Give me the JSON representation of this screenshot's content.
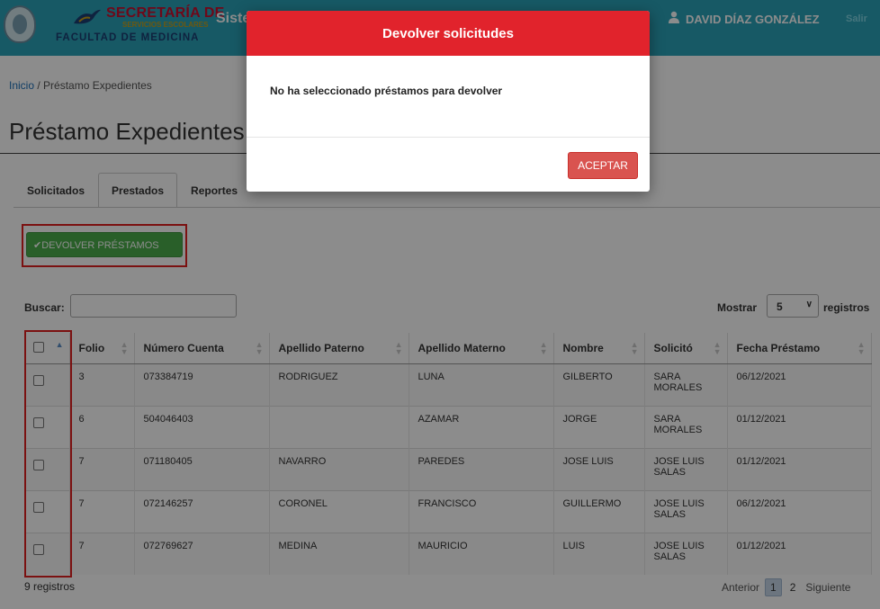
{
  "header": {
    "logo_line1": "SECRETARÍA DE",
    "logo_line2": "SERVICIOS ESCOLARES",
    "logo_line3": "FACULTAD DE MEDICINA",
    "system_title": "Siste",
    "user_name": "DAVID DÍAZ GONZÁLEZ",
    "logout_label": "Salir"
  },
  "breadcrumb": {
    "home": "Inicio",
    "separator": " / ",
    "current": "Préstamo Expedientes"
  },
  "page_title": "Préstamo Expedientes",
  "tabs": [
    {
      "label": "Solicitados",
      "active": false
    },
    {
      "label": "Prestados",
      "active": true
    },
    {
      "label": "Reportes",
      "active": false
    }
  ],
  "return_button_label": "✔DEVOLVER PRÉSTAMOS",
  "search": {
    "label": "Buscar:",
    "value": ""
  },
  "page_size": {
    "prefix": "Mostrar",
    "value": "5",
    "suffix": "registros"
  },
  "table": {
    "columns": [
      "",
      "Folio",
      "Número Cuenta",
      "Apellido Paterno",
      "Apellido Materno",
      "Nombre",
      "Solicitó",
      "Fecha Préstamo"
    ],
    "rows": [
      [
        "3",
        "073384719",
        "RODRIGUEZ",
        "LUNA",
        "GILBERTO",
        "SARA MORALES",
        "06/12/2021"
      ],
      [
        "6",
        "504046403",
        "",
        "AZAMAR",
        "JORGE",
        "SARA MORALES",
        "01/12/2021"
      ],
      [
        "7",
        "071180405",
        "NAVARRO",
        "PAREDES",
        "JOSE LUIS",
        "JOSE LUIS SALAS",
        "01/12/2021"
      ],
      [
        "7",
        "072146257",
        "CORONEL",
        "FRANCISCO",
        "GUILLERMO",
        "JOSE LUIS SALAS",
        "06/12/2021"
      ],
      [
        "7",
        "072769627",
        "MEDINA",
        "MAURICIO",
        "LUIS",
        "JOSE LUIS SALAS",
        "01/12/2021"
      ]
    ]
  },
  "footer": {
    "info": "9 registros"
  },
  "pagination": {
    "prev": "Anterior",
    "pages": [
      "1",
      "2"
    ],
    "current": "1",
    "next": "Siguiente"
  },
  "modal": {
    "title": "Devolver solicitudes",
    "message": "No ha seleccionado préstamos para devolver",
    "accept_label": "ACEPTAR"
  },
  "colors": {
    "header_bg": "#2aa3b9",
    "modal_header": "#e1232c",
    "accept_button": "#d9534f",
    "return_button": "#4cae4c",
    "highlight_box": "#e02020"
  }
}
